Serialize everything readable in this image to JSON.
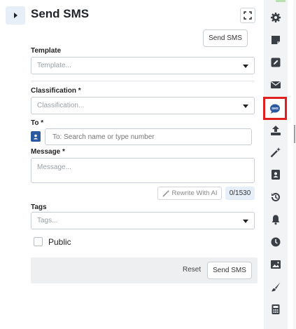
{
  "panel": {
    "title": "Send SMS",
    "send_top_label": "Send SMS"
  },
  "form": {
    "template": {
      "label": "Template",
      "placeholder": "Template..."
    },
    "classification": {
      "label": "Classification *",
      "placeholder": "Classification..."
    },
    "to": {
      "label": "To *",
      "placeholder": "To: Search name or type number"
    },
    "message": {
      "label": "Message *",
      "placeholder": "Message...",
      "counter": "0/1530"
    },
    "rewrite_label": "Rewrite With AI",
    "tags": {
      "label": "Tags",
      "placeholder": "Tags..."
    },
    "public_label": "Public"
  },
  "footer": {
    "reset_label": "Reset",
    "send_label": "Send SMS"
  },
  "sidebar": {
    "items": [
      {
        "icon": "gear-icon"
      },
      {
        "icon": "note-icon"
      },
      {
        "icon": "edit-icon"
      },
      {
        "icon": "envelope-icon"
      },
      {
        "icon": "sms-icon",
        "active": true
      },
      {
        "icon": "upload-icon"
      },
      {
        "icon": "magic-wand-icon"
      },
      {
        "icon": "contact-card-icon"
      },
      {
        "icon": "history-icon"
      },
      {
        "icon": "bell-icon"
      },
      {
        "icon": "clock-icon"
      },
      {
        "icon": "image-icon"
      },
      {
        "icon": "brush-icon"
      },
      {
        "icon": "calculator-icon"
      }
    ]
  },
  "colors": {
    "accent": "#2c5aa0",
    "active_border": "#e0201f",
    "counter_bg": "#e6eef8",
    "footer_bg": "#eeeff1"
  }
}
